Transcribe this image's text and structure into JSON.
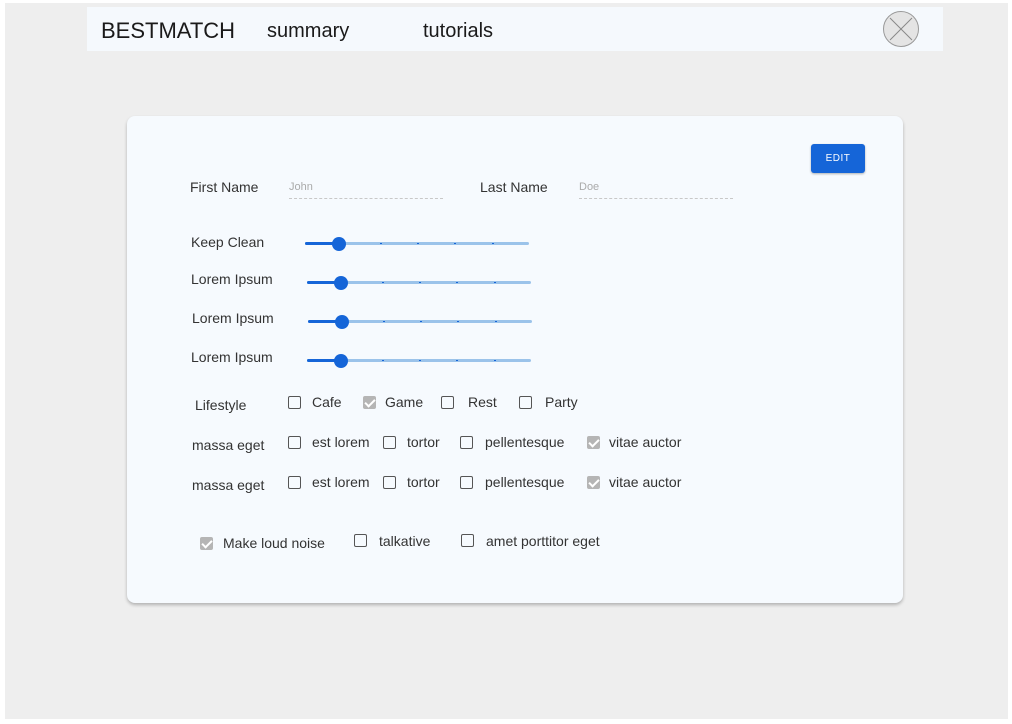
{
  "topbar": {
    "brand": "BESTMATCH",
    "nav": [
      "summary",
      "tutorials"
    ],
    "avatar_icon": "user-placeholder-icon"
  },
  "profile": {
    "edit_label": "EDIT",
    "first_name_label": "First Name",
    "first_name_value": "John",
    "last_name_label": "Last Name",
    "last_name_value": "Doe"
  },
  "sliders": [
    {
      "label": "Keep Clean",
      "value": 0.15
    },
    {
      "label": "Lorem Ipsum",
      "value": 0.15
    },
    {
      "label": "Lorem Ipsum",
      "value": 0.15
    },
    {
      "label": "Lorem Ipsum",
      "value": 0.15
    }
  ],
  "checkbox_rows": [
    {
      "label": "Lifestyle",
      "options": [
        {
          "label": "Cafe",
          "checked": false
        },
        {
          "label": "Game",
          "checked": true
        },
        {
          "label": "Rest",
          "checked": false
        },
        {
          "label": "Party",
          "checked": false
        }
      ]
    },
    {
      "label": "massa eget",
      "options": [
        {
          "label": "est lorem",
          "checked": false
        },
        {
          "label": "tortor",
          "checked": false
        },
        {
          "label": "pellentesque",
          "checked": false
        },
        {
          "label": "vitae auctor",
          "checked": true
        }
      ]
    },
    {
      "label": "massa eget",
      "options": [
        {
          "label": "est lorem",
          "checked": false
        },
        {
          "label": "tortor",
          "checked": false
        },
        {
          "label": "pellentesque",
          "checked": false
        },
        {
          "label": "vitae auctor",
          "checked": true
        }
      ]
    }
  ],
  "traits": [
    {
      "label": "Make loud noise",
      "checked": true
    },
    {
      "label": "talkative",
      "checked": false
    },
    {
      "label": "amet porttitor eget",
      "checked": false
    }
  ],
  "colors": {
    "accent": "#1565d8",
    "track": "#9bc3ea",
    "checked_box": "#b5b5b5"
  }
}
